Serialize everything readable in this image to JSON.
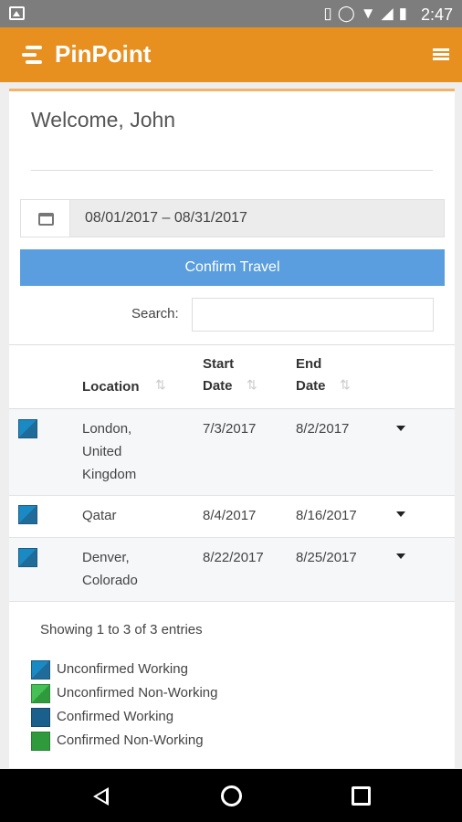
{
  "status_bar": {
    "time": "2:47",
    "icons": [
      "vibrate-icon",
      "alarm-icon",
      "wifi-icon",
      "signal-icon",
      "battery-icon"
    ]
  },
  "app_bar": {
    "brand": "PinPoint",
    "brand_color": "#e8901f"
  },
  "welcome": "Welcome, John",
  "date_range": {
    "value": "08/01/2017 – 08/31/2017"
  },
  "confirm_button": "Confirm Travel",
  "search": {
    "label": "Search:",
    "value": ""
  },
  "table": {
    "columns": {
      "location": "Location",
      "start_line1": "Start",
      "start_line2": "Date",
      "end_line1": "End",
      "end_line2": "Date"
    },
    "rows": [
      {
        "location": [
          "London,",
          "United",
          "Kingdom"
        ],
        "start": "7/3/2017",
        "end": "8/2/2017"
      },
      {
        "location": [
          "Qatar"
        ],
        "start": "8/4/2017",
        "end": "8/16/2017"
      },
      {
        "location": [
          "Denver,",
          "Colorado"
        ],
        "start": "8/22/2017",
        "end": "8/25/2017"
      }
    ]
  },
  "showing": "Showing 1 to 3 of 3 entries",
  "legend": [
    {
      "label": "Unconfirmed Working",
      "color": "#1a8ac4"
    },
    {
      "label": "Unconfirmed Non-Working",
      "color": "#3cb54a"
    },
    {
      "label": "Confirmed Working",
      "color": "#1b5f8c"
    },
    {
      "label": "Confirmed Non-Working",
      "color": "#2f9a3c"
    }
  ]
}
